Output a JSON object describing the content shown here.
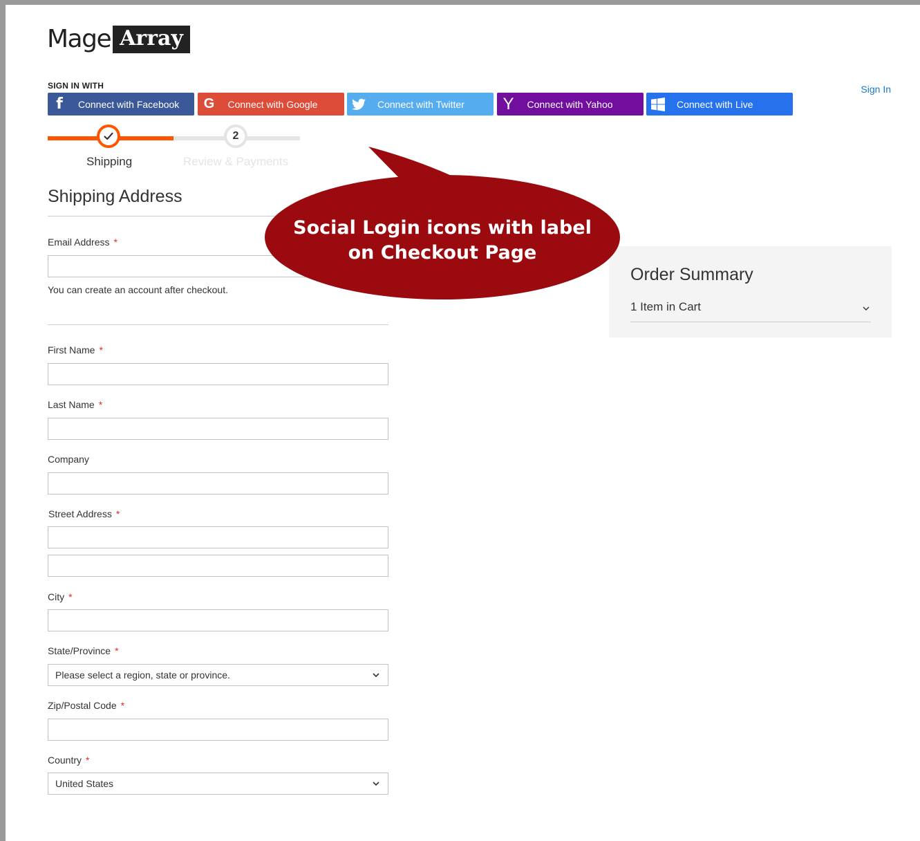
{
  "logo": {
    "light": "Mage",
    "dark": "Array"
  },
  "signin": {
    "title": "SIGN IN WITH",
    "link": "Sign In",
    "buttons": [
      {
        "label": "Connect with Facebook",
        "icon": "facebook-icon",
        "color": "#3b5998"
      },
      {
        "label": "Connect with Google",
        "icon": "google-icon",
        "color": "#dd4b39"
      },
      {
        "label": "Connect with Twitter",
        "icon": "twitter-icon",
        "color": "#55acee"
      },
      {
        "label": "Connect with Yahoo",
        "icon": "yahoo-icon",
        "color": "#720e9e"
      },
      {
        "label": "Connect with Live",
        "icon": "windows-icon",
        "color": "#2672ec"
      }
    ]
  },
  "progress": {
    "accent": "#ff5501",
    "steps": [
      {
        "label": "Shipping",
        "state": "complete"
      },
      {
        "number": "2",
        "label": "Review & Payments",
        "state": "pending"
      }
    ]
  },
  "shipping": {
    "title": "Shipping Address",
    "email": {
      "label": "Email Address",
      "note": "You can create an account after checkout."
    },
    "fields": {
      "first_name": "First Name",
      "last_name": "Last Name",
      "company": "Company",
      "street": "Street Address",
      "city": "City",
      "state": "State/Province",
      "zip": "Zip/Postal Code",
      "country": "Country"
    },
    "required_marker": "*",
    "state_value": "Please select a region, state or province.",
    "country_value": "United States"
  },
  "summary": {
    "title": "Order Summary",
    "items": "1 Item in Cart"
  },
  "callout": {
    "line1": "Social Login icons with label",
    "line2": "on Checkout Page",
    "color": "#9b0a0f"
  }
}
